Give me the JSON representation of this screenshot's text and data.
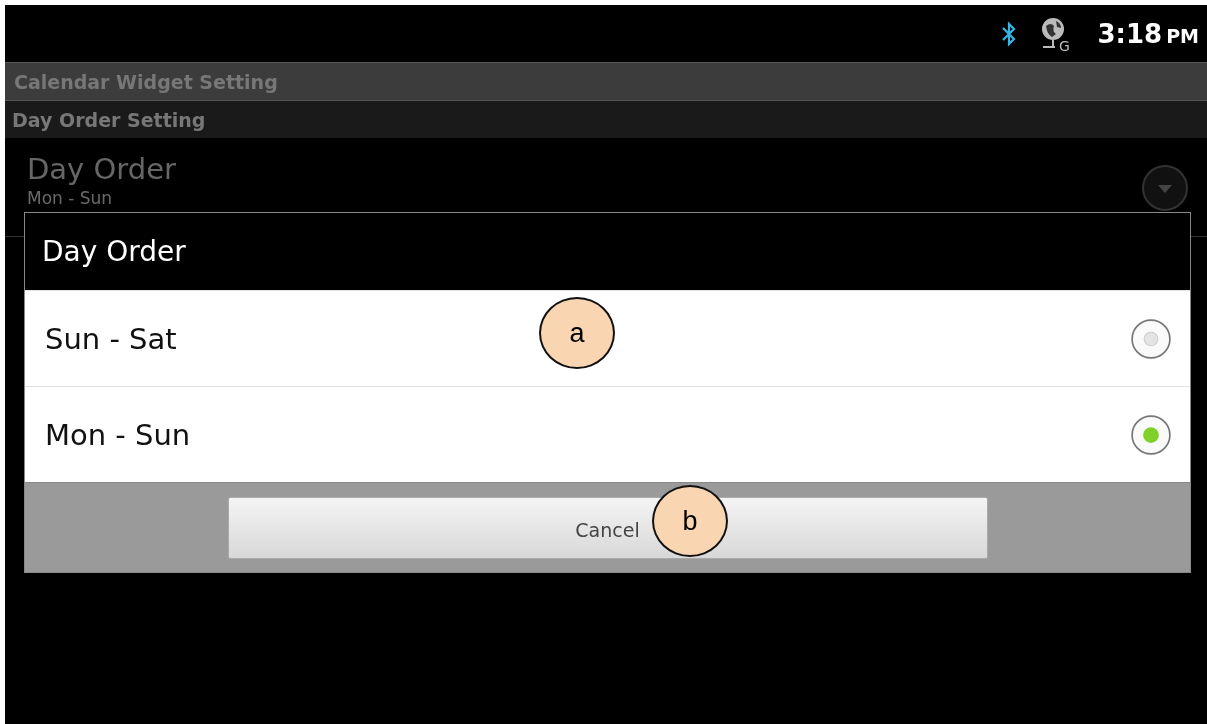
{
  "status_bar": {
    "network_type": "G",
    "time": "3:18",
    "meridiem": "PM"
  },
  "title_bar": {
    "title": "Calendar Widget Setting"
  },
  "section_header": {
    "title": "Day Order Setting"
  },
  "preference": {
    "title": "Day Order",
    "summary": "Mon - Sun"
  },
  "dialog": {
    "title": "Day Order",
    "options": [
      {
        "label": "Sun - Sat",
        "selected": false
      },
      {
        "label": "Mon - Sun",
        "selected": true
      }
    ],
    "buttons": [
      "Cancel"
    ]
  },
  "callouts": [
    {
      "label": "a"
    },
    {
      "label": "b"
    }
  ]
}
